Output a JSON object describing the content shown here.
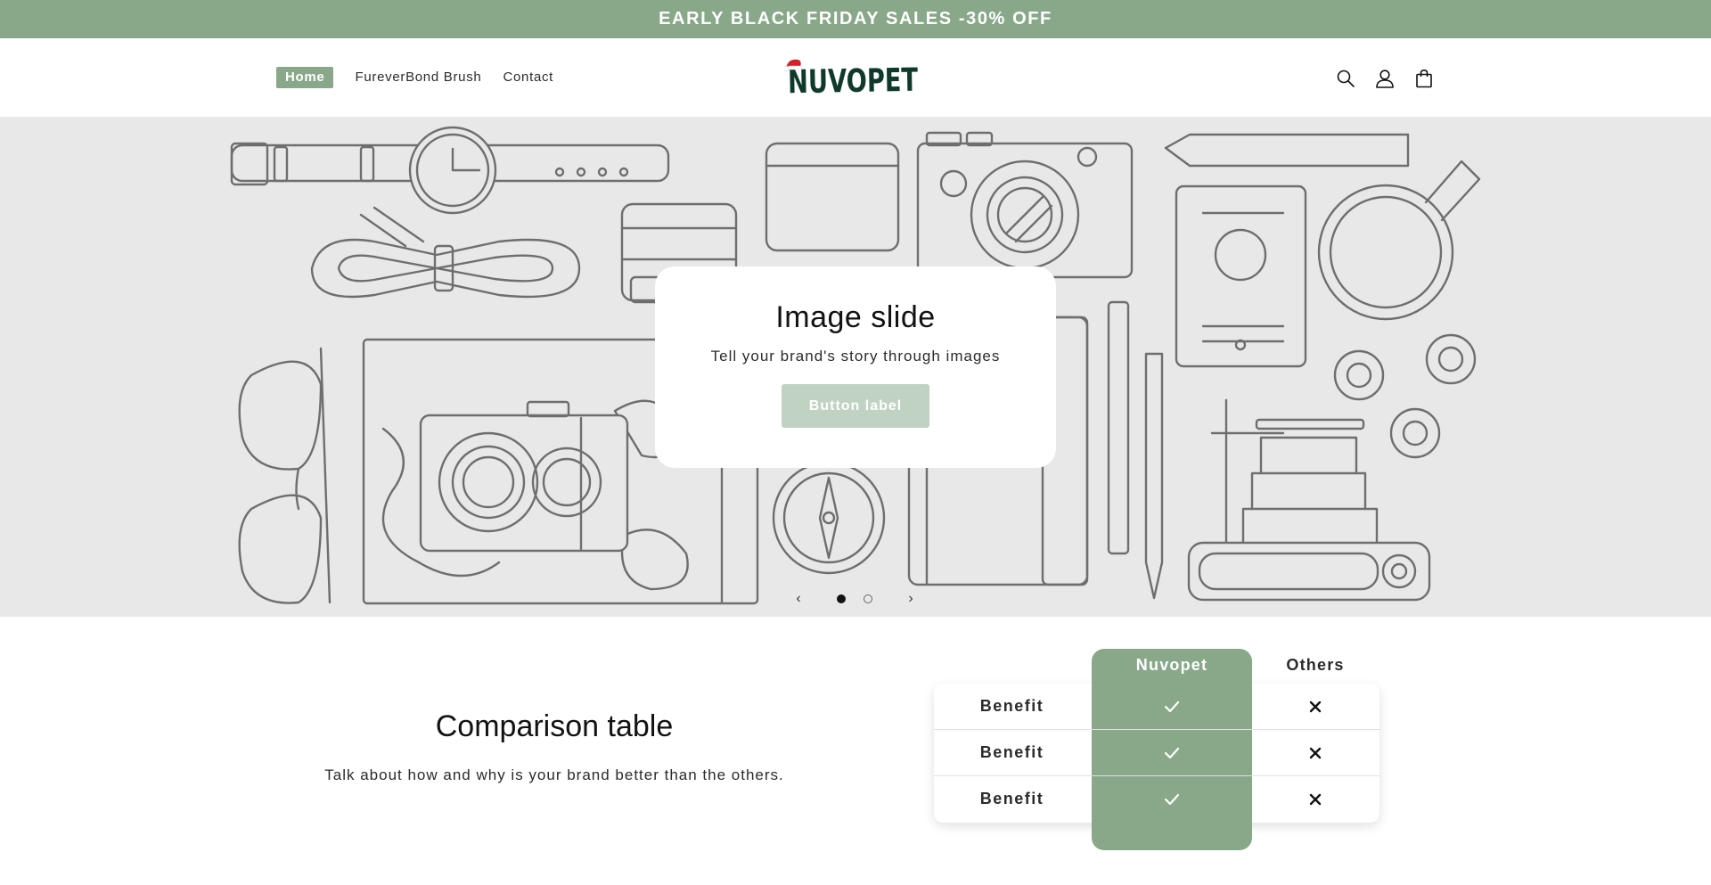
{
  "announcement": {
    "text": "EARLY BLACK FRIDAY SALES -30% OFF"
  },
  "header": {
    "nav": [
      {
        "label": "Home",
        "active": true
      },
      {
        "label": "FureverBond Brush",
        "active": false
      },
      {
        "label": "Contact",
        "active": false
      }
    ],
    "logo_text": "NUVOPET",
    "icons": [
      "search-icon",
      "account-icon",
      "cart-icon"
    ]
  },
  "hero": {
    "title": "Image slide",
    "subtitle": "Tell your brand's story through images",
    "button_label": "Button label",
    "prev_label": "‹",
    "next_label": "›",
    "slides_total": 2,
    "current_slide": 1
  },
  "comparison": {
    "title": "Comparison table",
    "subtitle": "Talk about how and why is your brand better than the others.",
    "columns": [
      "Nuvopet",
      "Others"
    ],
    "rows": [
      {
        "label": "Benefit",
        "nuvopet": true,
        "others": false
      },
      {
        "label": "Benefit",
        "nuvopet": true,
        "others": false
      },
      {
        "label": "Benefit",
        "nuvopet": true,
        "others": false
      }
    ]
  },
  "colors": {
    "accent_green": "#88a889",
    "button_muted": "#c0d2c1",
    "logo_dark": "#0f3a2b",
    "santa_red": "#d4202a",
    "hero_bg": "#e8e8e8"
  }
}
